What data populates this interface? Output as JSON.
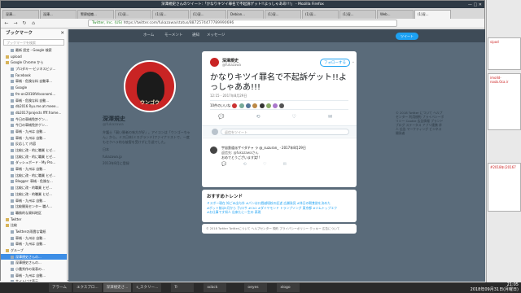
{
  "window": {
    "title": "深澤規史さんのツイート:「かなりキツイ罪名で不起訴ゲット!!よっしゃああ!!!」 - Mozilla Firefox",
    "controls": "— □ ✕"
  },
  "tabs": [
    "深澤...",
    "深澤...",
    "警察組織...",
    "(1)深...",
    "(1)深...",
    "(1)深...",
    "Debian...",
    "(1)深...",
    "(1)深...",
    "(1)深...",
    "Web...",
    "(1)深..."
  ],
  "nav": {
    "back": "←",
    "forward": "→",
    "reload": "↻",
    "home": "⌂",
    "url": "https://twitter.com/fukazawa/status/8872574477789990696",
    "identity": "Twitter, Inc. (US)"
  },
  "sidebar": {
    "title": "ブックマーク",
    "close": "✕",
    "search_placeholder": "ブックマークを検索",
    "items": [
      {
        "label": "最新 設定 - Google 検索",
        "folder": false
      },
      {
        "label": "upload",
        "folder": true
      },
      {
        "label": "Google Chrome から",
        "folder": true
      },
      {
        "label": "プロダキー-ビジネスビジ...",
        "folder": false
      },
      {
        "label": "Facebook",
        "folder": false
      },
      {
        "label": "車械 - 危険な料 自動車...",
        "folder": false
      },
      {
        "label": "Google",
        "folder": false
      },
      {
        "label": "fm-oni2016fkfoconomi...",
        "folder": false
      },
      {
        "label": "車械 - 危険な料 自動...",
        "folder": false
      },
      {
        "label": "db2016 Ryu.me.at meee...",
        "folder": false
      },
      {
        "label": "db2017/projects ffff.frame...",
        "folder": false
      },
      {
        "label": "今日の車械免許ゲン...",
        "folder": false
      },
      {
        "label": "今日の車械免許ゲン...",
        "folder": false
      },
      {
        "label": "車械 - 九州は 自動...",
        "folder": false
      },
      {
        "label": "車械 - 九州は 自動...",
        "folder": false
      },
      {
        "label": "反応して 内容",
        "folder": false
      },
      {
        "label": "比較に改 - 的に職業 ヒゼ...",
        "folder": false
      },
      {
        "label": "比較に改 - 的に職業 ヒゼ...",
        "folder": false
      },
      {
        "label": "ダッシュボード - My Pro...",
        "folder": false
      },
      {
        "label": "車械 - 九州は 自動...",
        "folder": false
      },
      {
        "label": "比較に改 - 的に職業 ヒゼ...",
        "folder": false
      },
      {
        "label": "Blogger: 車械 - 危険な...",
        "folder": false
      },
      {
        "label": "比較に改 - 的職業 ヒゼ...",
        "folder": false
      },
      {
        "label": "比較に改 - 的職業 ヒゼ...",
        "folder": false
      },
      {
        "label": "車械 - 九州は 自動...",
        "folder": false
      },
      {
        "label": "比較開発センター 職人...",
        "folder": false
      },
      {
        "label": "職務的な資料地区",
        "folder": false
      },
      {
        "label": "Twitter",
        "folder": true
      },
      {
        "label": "比較",
        "folder": true
      },
      {
        "label": "Twitterの雨雲な電紙",
        "folder": false
      },
      {
        "label": "車械 - 九州は 自動...",
        "folder": false
      },
      {
        "label": "車械 - 九州は 自動...",
        "folder": false
      },
      {
        "label": "グループ",
        "folder": true
      },
      {
        "label": "深澤規史さんの...",
        "folder": false,
        "selected": true
      },
      {
        "label": "深澤規史さんの...",
        "folder": false
      },
      {
        "label": "小農秀作の発表の...",
        "folder": false
      },
      {
        "label": "車械 - 九州は 自動...",
        "folder": false
      },
      {
        "label": "サイトには表示...",
        "folder": false
      },
      {
        "label": "グループ",
        "folder": true
      }
    ]
  },
  "twitter": {
    "nav_items": [
      "ホーム",
      "モーメント",
      "通知",
      "メッセージ"
    ],
    "tweet_button": "ツイート",
    "profile": {
      "name": "深澤規史",
      "handle": "@fukazawa",
      "bio": "弁護士「弱い勝者の味方が好」。アイコンは「ウンゴーちゃん」から。ミス日本(ミスグランド)ファイナリストで、一度もセクハラ的な被害を受けずに引退でした。",
      "location": "日本",
      "link": "fukazawa.jp",
      "joined": "2013年8月に登録"
    },
    "avatar_text": "ウンゴウ",
    "side_footer": "© 2018 Twitter について ヘルプセンター 利用規約 プライバシーポリシー Cookie 広告情報 ブランド ブログ ステータス アプリ連携 求人 広告 マーケティング ビジネス 開発者"
  },
  "modal": {
    "name": "深澤規史",
    "handle": "@fukazawa",
    "follow_label": "フォローする",
    "chevron": "⌄",
    "text": "かなりキツイ罪名で不起訴ゲット!!よっしゃああ!!!",
    "timestamp": "12:15 - 2017年8月29日",
    "stats": "10件のいいね",
    "actions": [
      "💬",
      "⟲",
      "♡",
      "✉"
    ],
    "reply_placeholder": "返信をツイート",
    "reply": {
      "author": "宇宙鉄道派ザイダチャ ラ @_suzuran_ · 2017年8月29日",
      "to": "返信先: @fukazawaさん",
      "text": "おめでとうございます笑!!",
      "actions": [
        "💬",
        "⟲",
        "♡",
        "✉"
      ]
    }
  },
  "trends": {
    "title": "おすすめトレンド",
    "items": [
      "ミスポー現在 知ごみ出与外 #パンは口唇越境校の記述 広瀬発見 #休日の朝食欲を決めた",
      "#ボット前は5月から 子/ロサ #Ch2 #ダイヤモンド トランプソング 東京都 #ジムトップエク",
      "#お仕事です知人 出来たに一生の 表現"
    ]
  },
  "footer": "© 2018 Twitter Twitterについて ヘルプセンター 規約 プライバシーポリシー クッキー 広告について",
  "right_strip": {
    "label1": "sipod",
    "label2": "imolld-noob.0ca.ir",
    "label3": "#2018年(20167"
  },
  "taskbar": {
    "items": [
      "",
      "",
      "",
      "",
      "",
      "",
      "アラーム",
      "エクスプロ...",
      "深澤規史さ...",
      "s_スクリー...",
      "",
      "Tr",
      "",
      "xcbck",
      "",
      "",
      "oeyes",
      "",
      "xlogo"
    ],
    "clock_time": "21:05",
    "clock_date": "2018年09月31日(月曜日)"
  }
}
